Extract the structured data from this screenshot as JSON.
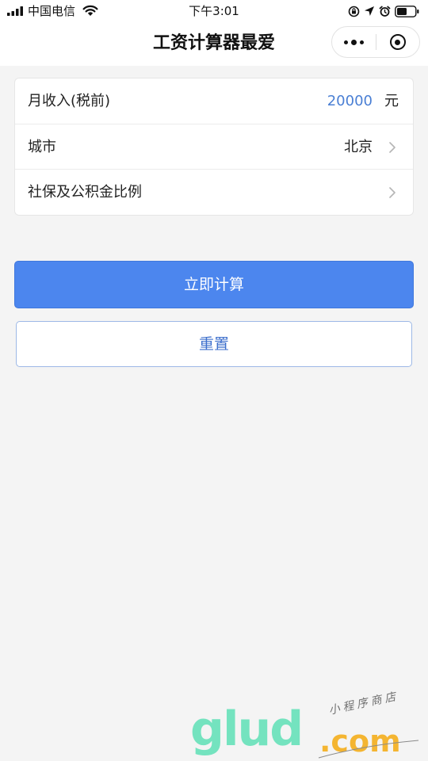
{
  "status_bar": {
    "carrier": "中国电信",
    "time": "下午3:01"
  },
  "nav": {
    "title": "工资计算器最爱"
  },
  "form": {
    "salary_label": "月收入(税前)",
    "salary_value": "20000",
    "salary_unit": "元",
    "city_label": "城市",
    "city_value": "北京",
    "ratio_label": "社保及公积金比例"
  },
  "actions": {
    "calculate_label": "立即计算",
    "reset_label": "重置"
  },
  "watermark": {
    "brand": "glud",
    "tld": ".com",
    "tagline": "小程序商店"
  },
  "colors": {
    "primary_button": "#4c86ee",
    "value_blue": "#4a7fd4",
    "background": "#f4f4f4"
  },
  "icons": {
    "signal": "signal-bars-icon",
    "wifi": "wifi-icon",
    "orientation_lock": "orientation-lock-icon",
    "location": "location-arrow-icon",
    "alarm": "alarm-clock-icon",
    "battery": "battery-icon",
    "more": "more-dots-icon",
    "close": "close-circle-icon",
    "chevron": "chevron-right-icon"
  }
}
